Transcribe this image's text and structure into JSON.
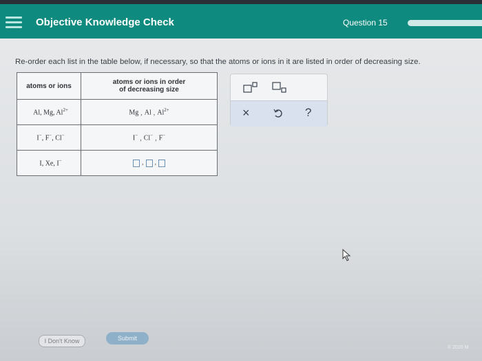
{
  "header": {
    "title": "Objective Knowledge Check",
    "question_label": "Question 15",
    "menu_icon": "hamburger-icon"
  },
  "question": {
    "text": "Re-order each list in the table below, if necessary, so that the atoms or ions in it are listed in order of decreasing size."
  },
  "table": {
    "col1_header": "atoms or ions",
    "col2_header_line1": "atoms or ions in order",
    "col2_header_line2": "of decreasing size",
    "rows": [
      {
        "given": "Al, Mg, Al",
        "given_sup": "2+",
        "answer": [
          "Mg",
          "Al",
          "Al"
        ],
        "answer_sups": [
          "",
          "",
          "2+"
        ]
      },
      {
        "given": "I",
        "given_list": [
          "I",
          "F",
          "Cl"
        ],
        "given_sups": [
          "−",
          "−",
          "−"
        ],
        "answer": [
          "I",
          "Cl",
          "F"
        ],
        "answer_sups": [
          "−",
          "−",
          "−"
        ]
      },
      {
        "given": "I, Xe, I",
        "given_sup": "−",
        "answer": [
          "",
          "",
          ""
        ]
      }
    ]
  },
  "toolbox": {
    "icons": [
      "superscript-box-icon",
      "subscript-box-icon",
      "clear-x-icon",
      "undo-icon",
      "help-question-icon"
    ],
    "clear_symbol": "×",
    "help_symbol": "?"
  },
  "buttons": {
    "dont_know": "I Don't Know",
    "submit": "Submit"
  },
  "footer": {
    "copyright": "© 2020 M"
  },
  "colors": {
    "header_bg": "#0f8a7f",
    "submit_bg": "#8fb0c9"
  }
}
